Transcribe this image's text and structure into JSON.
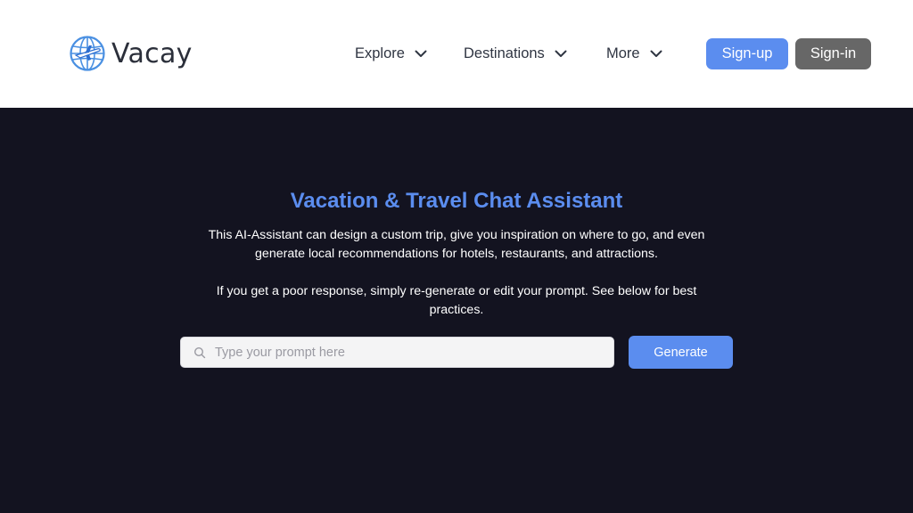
{
  "header": {
    "brand": "Vacay",
    "nav": [
      {
        "label": "Explore"
      },
      {
        "label": "Destinations"
      },
      {
        "label": "More"
      }
    ],
    "signup_label": "Sign-up",
    "signin_label": "Sign-in"
  },
  "hero": {
    "title": "Vacation & Travel Chat Assistant",
    "description_1": "This AI-Assistant can design a custom trip, give you inspiration on where to go, and even generate local recommendations for hotels, restaurants, and attractions.",
    "description_2": "If you get a poor response, simply re-generate or edit your prompt. See below for best practices.",
    "prompt_placeholder": "Type your prompt here",
    "prompt_value": "",
    "generate_label": "Generate"
  },
  "colors": {
    "accent": "#5b8def",
    "signin": "#676767",
    "hero_bg": "#131320",
    "header_bg": "#ffffff"
  },
  "icons": {
    "logo": "globe-airplane-icon",
    "nav_chevron": "chevron-down-icon",
    "prompt": "search-icon"
  }
}
